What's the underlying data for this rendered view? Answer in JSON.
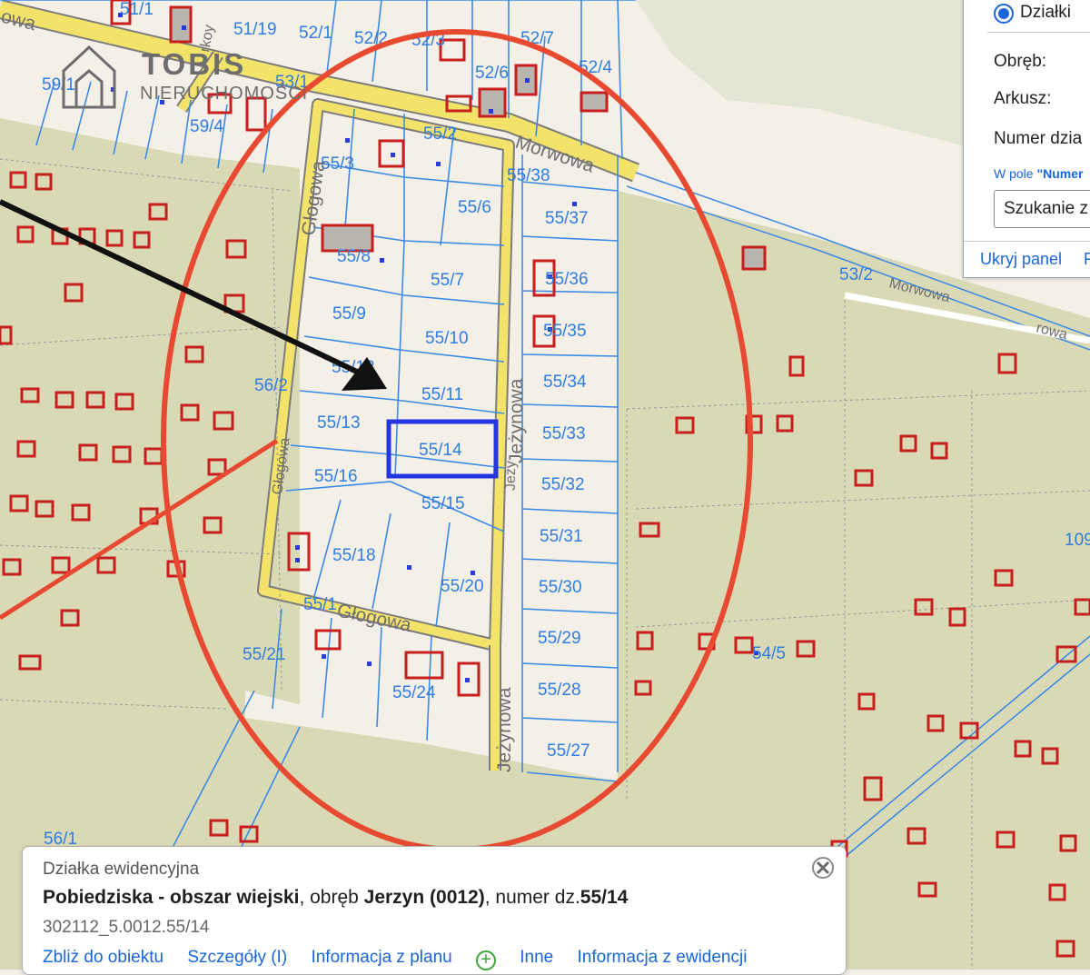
{
  "map": {
    "streets": {
      "glogowa_vertical": "Głogowa",
      "glogowa_bottom": "Głogowa",
      "glogowa_small": "Głogowa",
      "jezynowa_vertical": "Jeżynowa",
      "jezynowa_lower": "Jeżynowa",
      "jezynowa_small": "Jeży",
      "morwowa_top": "Morwowa",
      "morwowa_right": "Morwowa",
      "morwowa_far": "rowa",
      "top_left": "owa",
      "top_vertical": "rkoy"
    },
    "parcels": {
      "p51_1": "51/1",
      "p51_19": "51/19",
      "p52_1": "52/1",
      "p52_2": "52/2",
      "p52_3": "52/3",
      "p52_7": "52/7",
      "p52_6": "52/6",
      "p52_4": "52/4",
      "p59_1": "59/1",
      "p59_4": "59/4",
      "p53_1": "53/1",
      "p53_2": "53/2",
      "p55_2": "55/2",
      "p55_3": "55/3",
      "p55_38": "55/38",
      "p55_6": "55/6",
      "p55_37": "55/37",
      "p55_8": "55/8",
      "p55_7": "55/7",
      "p55_36": "55/36",
      "p55_9": "55/9",
      "p55_10": "55/10",
      "p55_35": "55/35",
      "p55_12": "55/12",
      "p56_2": "56/2",
      "p55_11": "55/11",
      "p55_34": "55/34",
      "p55_13": "55/13",
      "p55_14": "55/14",
      "p55_33": "55/33",
      "p55_16": "55/16",
      "p55_15": "55/15",
      "p55_32": "55/32",
      "p55_31": "55/31",
      "p55_18": "55/18",
      "p55_20": "55/20",
      "p55_30": "55/30",
      "p55_1": "55/1",
      "p55_29": "55/29",
      "p55_21": "55/21",
      "p55_24": "55/24",
      "p55_28": "55/28",
      "p55_27": "55/27",
      "p54_5": "54/5",
      "p56_1": "56/1",
      "p109": "109"
    }
  },
  "logo": {
    "title": "TOBIS",
    "subtitle": "NIERUCHOMOŚCI"
  },
  "panel": {
    "radio_label": "Działki",
    "obreb_label": "Obręb:",
    "arkusz_label": "Arkusz:",
    "numer_label": "Numer dzia",
    "hint_prefix": "W pole ",
    "hint_bold": "\"Numer",
    "search_value": "Szukanie z",
    "link_hide": "Ukryj panel",
    "link_more": "F"
  },
  "popup": {
    "title": "Działka ewidencyjna",
    "location_bold": "Pobiedziska - obszar wiejski",
    "obreb_text": ", obręb ",
    "obreb_bold": "Jerzyn (0012)",
    "numer_text": ", numer dz.",
    "numer_bold": "55/14",
    "identifier": "302112_5.0012.55/14",
    "links": {
      "zoom": "Zbliż do obiektu",
      "details": "Szczegóły (I)",
      "plan": "Informacja z planu",
      "plus": "+",
      "other": "Inne",
      "ewidencja": "Informacja z ewidencji"
    },
    "close_icon": "close-icon"
  },
  "colors": {
    "background": "#f4efe7",
    "green_area": "#d9d9b6",
    "road": "#f3e36a",
    "parcel_lines": "#3b8be6",
    "buildings": "#c81e1e",
    "highlight": "#2336e0",
    "ellipse": "#e84a31",
    "arrow": "#111111"
  }
}
